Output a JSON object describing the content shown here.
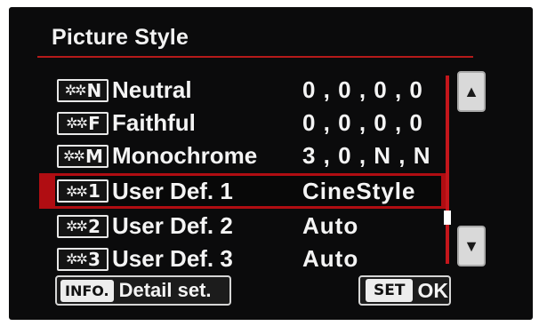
{
  "title": "Picture Style",
  "items": [
    {
      "icon_code": "N",
      "name": "Neutral",
      "value": "0 , 0 , 0 , 0",
      "selected": false
    },
    {
      "icon_code": "F",
      "name": "Faithful",
      "value": "0 , 0 , 0 , 0",
      "selected": false
    },
    {
      "icon_code": "M",
      "name": "Monochrome",
      "value": "3 , 0 , N , N",
      "selected": false
    },
    {
      "icon_code": "1",
      "name": "User Def. 1",
      "value": "CineStyle",
      "selected": true
    },
    {
      "icon_code": "2",
      "name": "User Def. 2",
      "value": "Auto",
      "selected": false
    },
    {
      "icon_code": "3",
      "name": "User Def. 3",
      "value": "Auto",
      "selected": false
    }
  ],
  "footer": {
    "info_key": "INFO.",
    "info_label": "Detail set.",
    "set_key": "SET",
    "set_label": "OK"
  },
  "icons": {
    "style_icon": "picture-style-burst-icon",
    "scroll_up": "triangle-up-icon",
    "scroll_down": "triangle-down-icon"
  },
  "colors": {
    "accent_red": "#b00d12",
    "background": "#0b0b0c",
    "text": "#f4f4f4"
  },
  "scroll": {
    "position_fraction": 0.72
  }
}
